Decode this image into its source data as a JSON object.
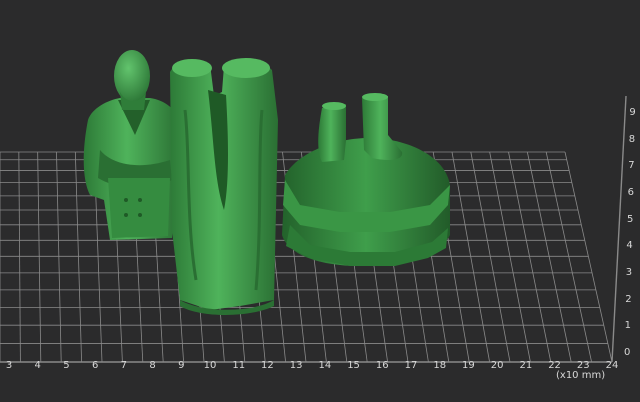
{
  "viewport": {
    "background": "#2b2b2c",
    "grid_color": "#8a8a8a",
    "model_color": "#3f9e4b",
    "x_axis": {
      "ticks": [
        "3",
        "4",
        "5",
        "6",
        "7",
        "8",
        "9",
        "10",
        "11",
        "12",
        "13",
        "14",
        "15",
        "16",
        "17",
        "18",
        "19",
        "20",
        "21",
        "22",
        "23",
        "24"
      ]
    },
    "y_axis": {
      "ticks": [
        "0",
        "1",
        "2",
        "3",
        "4",
        "5",
        "6",
        "7",
        "8",
        "9"
      ]
    },
    "unit_label": "(x10 mm)",
    "models": [
      "bust-figure",
      "legs-figure",
      "boots-pedestal-figure"
    ]
  }
}
